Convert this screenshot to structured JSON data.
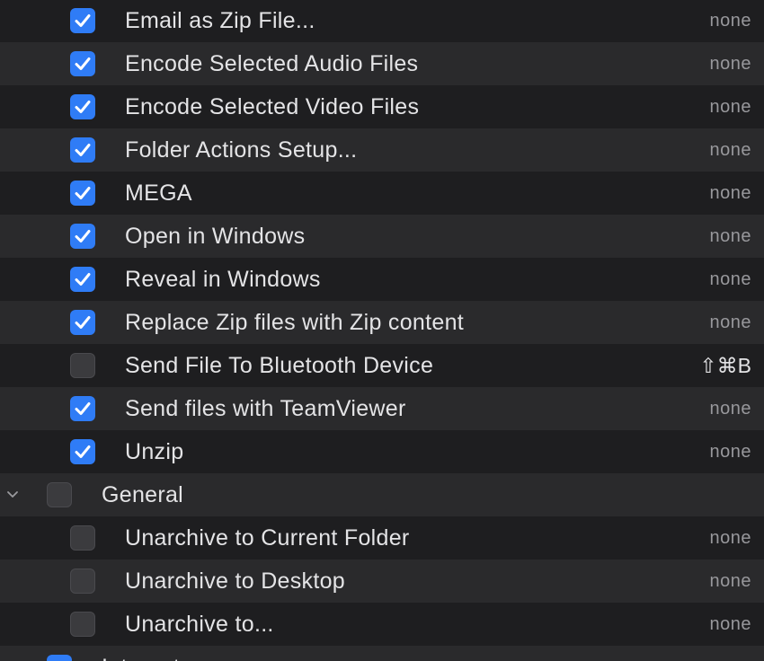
{
  "rows": [
    {
      "label": "Email as Zip File...",
      "checked": true,
      "shortcut": "none"
    },
    {
      "label": "Encode Selected Audio Files",
      "checked": true,
      "shortcut": "none"
    },
    {
      "label": "Encode Selected Video Files",
      "checked": true,
      "shortcut": "none"
    },
    {
      "label": "Folder Actions Setup...",
      "checked": true,
      "shortcut": "none"
    },
    {
      "label": "MEGA",
      "checked": true,
      "shortcut": "none"
    },
    {
      "label": "Open in Windows",
      "checked": true,
      "shortcut": "none"
    },
    {
      "label": "Reveal in Windows",
      "checked": true,
      "shortcut": "none"
    },
    {
      "label": "Replace Zip files with Zip content",
      "checked": true,
      "shortcut": "none"
    },
    {
      "label": "Send File To Bluetooth Device",
      "checked": false,
      "shortcut": "⇧⌘B"
    },
    {
      "label": "Send files with TeamViewer",
      "checked": true,
      "shortcut": "none"
    },
    {
      "label": "Unzip",
      "checked": true,
      "shortcut": "none"
    },
    {
      "label": "General",
      "checked": false,
      "shortcut": "",
      "group": true,
      "expanded": true
    },
    {
      "label": "Unarchive to Current Folder",
      "checked": false,
      "shortcut": "none"
    },
    {
      "label": "Unarchive to Desktop",
      "checked": false,
      "shortcut": "none"
    },
    {
      "label": "Unarchive to...",
      "checked": false,
      "shortcut": "none"
    },
    {
      "label": "Internet",
      "checked": true,
      "shortcut": "",
      "group": true,
      "expanded": false
    }
  ],
  "colors": {
    "accent": "#2f7cf6",
    "row_even": "#1e1e20",
    "row_odd": "#2a2a2c",
    "text": "#e4e4e6",
    "secondary_text": "#98989c"
  },
  "icons": {
    "checked": "checkmark-icon",
    "disclosure": "chevron-down-icon"
  }
}
